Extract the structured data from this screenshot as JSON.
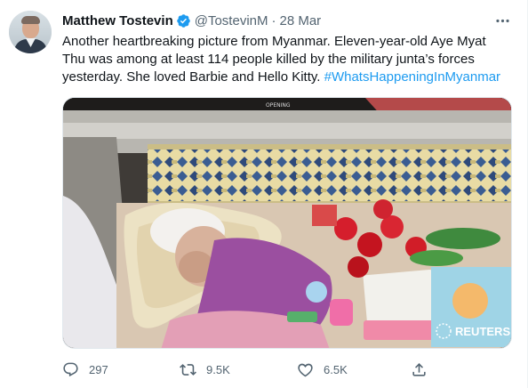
{
  "tweet": {
    "author_name": "Matthew Tostevin",
    "author_handle": "@TostevinM",
    "separator": "·",
    "date": "28 Mar",
    "text": "Another heartbreaking picture from Myanmar. Eleven-year-old Aye Myat Thu was among at least 114 people killed by the military junta’s forces yesterday. She loved Barbie and Hello Kitty. ",
    "hashtag": "#WhatsHappeningInMyanmar",
    "media": {
      "watermark": "REUTERS",
      "box_label": "OPENING"
    },
    "actions": {
      "replies": "297",
      "retweets": "9.5K",
      "likes": "6.5K"
    }
  },
  "icons": {
    "verified": "verified-badge-icon",
    "more": "more-options-icon",
    "reply": "reply-icon",
    "retweet": "retweet-icon",
    "like": "heart-icon",
    "share": "share-icon"
  },
  "colors": {
    "text": "#0f1419",
    "secondary": "#536471",
    "accent": "#1d9bf0"
  }
}
